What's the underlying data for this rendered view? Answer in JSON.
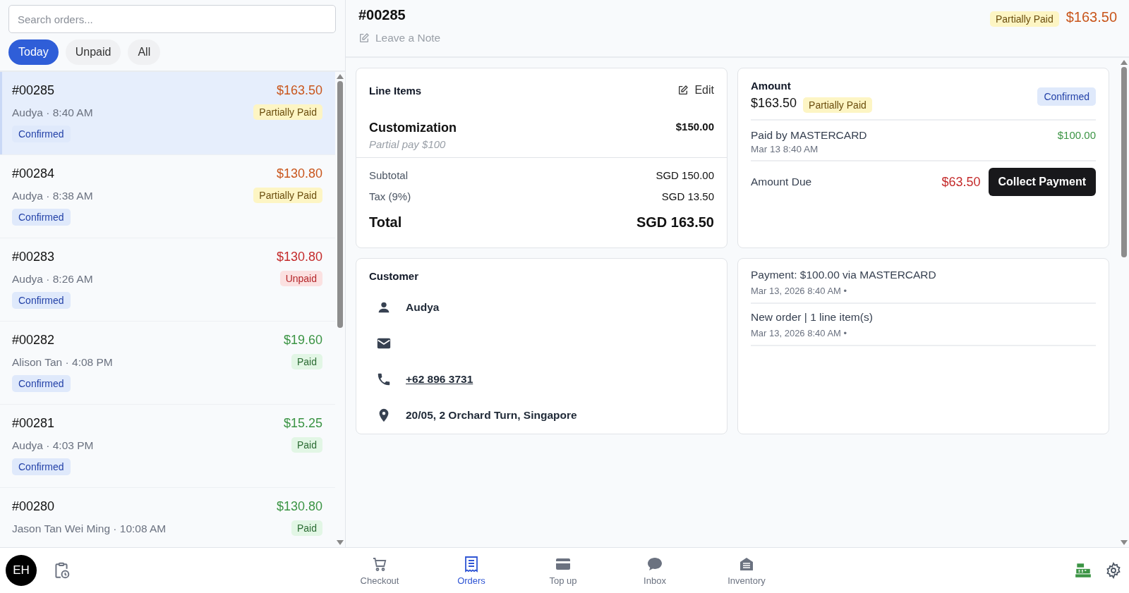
{
  "search": {
    "placeholder": "Search orders..."
  },
  "filters": [
    {
      "label": "Today",
      "selected": true
    },
    {
      "label": "Unpaid",
      "selected": false
    },
    {
      "label": "All",
      "selected": false
    }
  ],
  "orders": [
    {
      "id": "#00285",
      "amount": "$163.50",
      "meta": "Audya · 8:40 AM",
      "kind": "partial",
      "payment_label": "Partially Paid",
      "status": "Confirmed",
      "selected": true
    },
    {
      "id": "#00284",
      "amount": "$130.80",
      "meta": "Audya · 8:38 AM",
      "kind": "partial",
      "payment_label": "Partially Paid",
      "status": "Confirmed",
      "selected": false
    },
    {
      "id": "#00283",
      "amount": "$130.80",
      "meta": "Audya · 8:26 AM",
      "kind": "unpaid",
      "payment_label": "Unpaid",
      "status": "Confirmed",
      "selected": false
    },
    {
      "id": "#00282",
      "amount": "$19.60",
      "meta": "Alison Tan · 4:08 PM",
      "kind": "paid",
      "payment_label": "Paid",
      "status": "Confirmed",
      "selected": false
    },
    {
      "id": "#00281",
      "amount": "$15.25",
      "meta": "Audya · 4:03 PM",
      "kind": "paid",
      "payment_label": "Paid",
      "status": "Confirmed",
      "selected": false
    },
    {
      "id": "#00280",
      "amount": "$130.80",
      "meta": "Jason Tan Wei Ming · 10:08 AM",
      "kind": "paid",
      "payment_label": "Paid",
      "selected": false
    }
  ],
  "detail": {
    "id": "#00285",
    "note_placeholder": "Leave a Note",
    "kind": "partial",
    "payment_label": "Partially Paid",
    "amount": "$163.50"
  },
  "line_items": {
    "title": "Line Items",
    "edit": "Edit",
    "items": [
      {
        "name": "Customization",
        "note": "Partial pay $100",
        "price": "$150.00"
      }
    ],
    "subtotal_label": "Subtotal",
    "subtotal": "SGD 150.00",
    "tax_label": "Tax (9%)",
    "tax": "SGD 13.50",
    "total_label": "Total",
    "total": "SGD 163.50"
  },
  "amount_card": {
    "title": "Amount",
    "amount": "$163.50",
    "kind": "partial",
    "payment_label": "Partially Paid",
    "status": "Confirmed",
    "payment_line": {
      "label": "Paid by MASTERCARD",
      "date": "Mar 13 8:40 AM",
      "amount": "$100.00"
    },
    "due_label": "Amount Due",
    "due": "$63.50",
    "collect": "Collect Payment"
  },
  "customer": {
    "title": "Customer",
    "rows": [
      {
        "kind": "name",
        "text": "Audya"
      },
      {
        "kind": "email"
      },
      {
        "kind": "phone",
        "text": "+62 896 3731"
      },
      {
        "kind": "address",
        "text": "20/05, 2 Orchard Turn, Singapore"
      }
    ]
  },
  "activity": [
    {
      "text": "Payment: $100.00 via MASTERCARD",
      "time": "Mar 13, 2026 8:40 AM •"
    },
    {
      "text": "New order | 1 line item(s)",
      "time": "Mar 13, 2026 8:40 AM •"
    }
  ],
  "user": {
    "initials": "EH"
  },
  "nav": [
    {
      "label": "Checkout",
      "selected": false
    },
    {
      "label": "Orders",
      "selected": true
    },
    {
      "label": "Top up",
      "selected": false
    },
    {
      "label": "Inbox",
      "selected": false
    },
    {
      "label": "Inventory",
      "selected": false
    }
  ]
}
